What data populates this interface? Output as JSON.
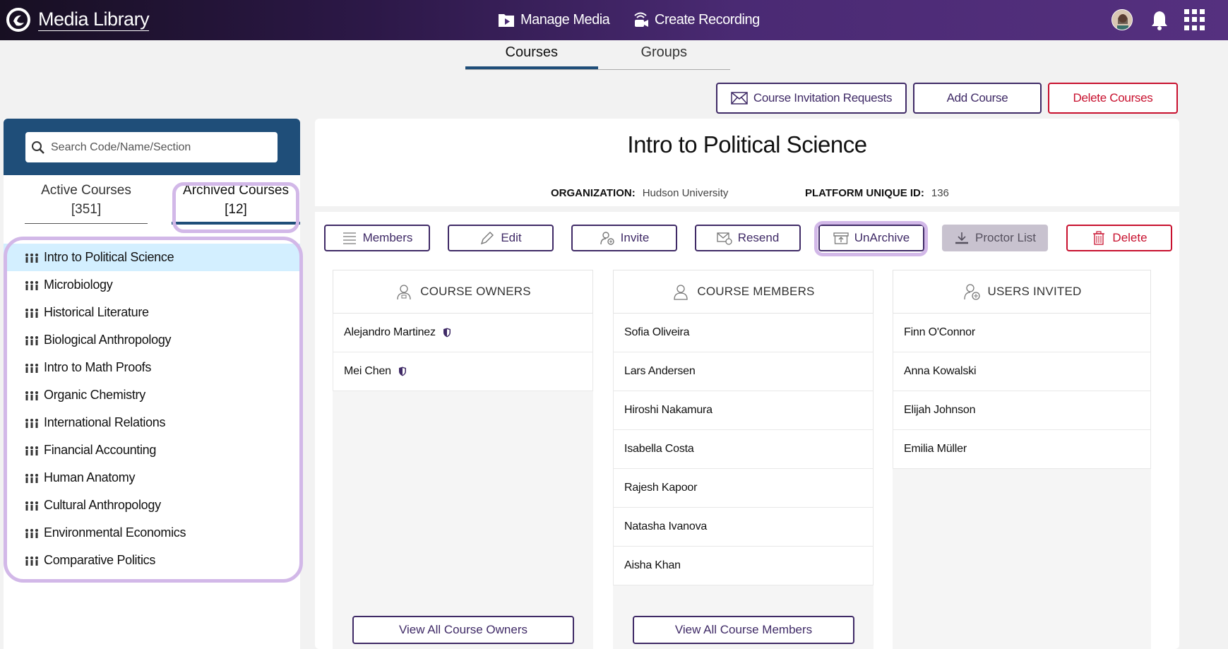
{
  "app": {
    "title": "Media Library"
  },
  "nav": {
    "manage_media": "Manage Media",
    "create_recording": "Create Recording"
  },
  "tabs": [
    {
      "label": "Courses",
      "active": true
    },
    {
      "label": "Groups",
      "active": false
    }
  ],
  "top_actions": {
    "invitation_requests": "Course Invitation Requests",
    "add_course": "Add Course",
    "delete_courses": "Delete Courses"
  },
  "search": {
    "placeholder": "Search Code/Name/Section"
  },
  "course_tabs": {
    "active_label": "Active Courses",
    "active_count": "[351]",
    "archived_label": "Archived Courses",
    "archived_count": "[12]"
  },
  "courses": [
    "Intro to Political Science",
    "Microbiology",
    "Historical Literature",
    "Biological Anthropology",
    "Intro to Math Proofs",
    "Organic Chemistry",
    "International Relations",
    "Financial Accounting",
    "Human Anatomy",
    "Cultural Anthropology",
    "Environmental Economics",
    "Comparative Politics"
  ],
  "selected_course": {
    "title": "Intro to Political Science",
    "org_label": "ORGANIZATION:",
    "org_value": "Hudson University",
    "pid_label": "PLATFORM UNIQUE ID:",
    "pid_value": "136"
  },
  "course_actions": {
    "members": "Members",
    "edit": "Edit",
    "invite": "Invite",
    "resend": "Resend",
    "unarchive": "UnArchive",
    "proctor_list": "Proctor List",
    "delete": "Delete"
  },
  "owners": {
    "header": "COURSE OWNERS",
    "items": [
      "Alejandro Martinez",
      "Mei Chen"
    ],
    "view_all": "View All Course Owners"
  },
  "members": {
    "header": "COURSE MEMBERS",
    "items": [
      "Sofia Oliveira",
      "Lars Andersen",
      "Hiroshi Nakamura",
      "Isabella Costa",
      "Rajesh Kapoor",
      "Natasha Ivanova",
      "Aisha Khan"
    ],
    "view_all": "View All Course Members"
  },
  "invited": {
    "header": "USERS INVITED",
    "items": [
      "Finn O'Connor",
      "Anna Kowalski",
      "Elijah Johnson",
      "Emilia Müller"
    ]
  },
  "colors": {
    "brand_purple": "#3f2a66",
    "header_blue": "#1f4e79",
    "danger": "#c8102e",
    "highlight": "#d2b8e8",
    "selected_row": "#d3efff"
  }
}
